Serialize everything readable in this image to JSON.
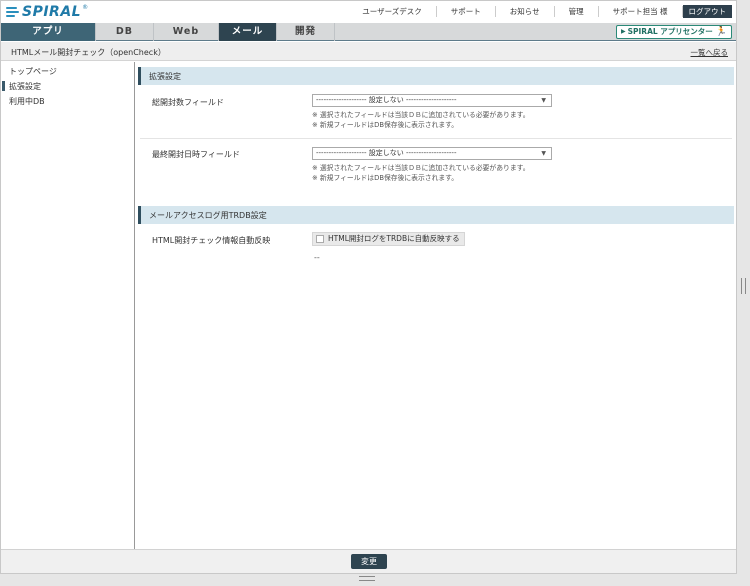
{
  "header": {
    "logo_text": "SPIRAL",
    "logo_reg": "®",
    "links": [
      "ユーザーズデスク",
      "サポート",
      "お知らせ",
      "管理",
      "サポート担当 様"
    ],
    "logout_label": "ログアウト"
  },
  "nav": {
    "tabs": [
      "アプリ",
      "DB",
      "Web",
      "メール",
      "開発"
    ],
    "active_tab": "メール",
    "app_center_label": "SPIRAL アプリセンター",
    "app_center_arrow": "▶",
    "app_center_icon": "person-running-icon"
  },
  "titlebar": {
    "title": "HTMLメール開封チェック（openCheck）",
    "back_link": "一覧へ戻る"
  },
  "sidebar": {
    "items": [
      "トップページ",
      "拡張設定",
      "利用中DB"
    ],
    "active_index": 1
  },
  "sections": {
    "extended": {
      "title": "拡張設定",
      "fields": [
        {
          "label": "総開封数フィールド",
          "select_value": "-------------------- 設定しない --------------------",
          "notes": [
            "※ 選択されたフィールドは当該ＤＢに追加されている必要があります。",
            "※ 新規フィールドはDB保存後に表示されます。"
          ]
        },
        {
          "label": "最終開封日時フィールド",
          "select_value": "-------------------- 設定しない --------------------",
          "notes": [
            "※ 選択されたフィールドは当該ＤＢに追加されている必要があります。",
            "※ 新規フィールドはDB保存後に表示されます。"
          ]
        }
      ]
    },
    "trdb": {
      "title": "メールアクセスログ用TRDB設定",
      "label": "HTML開封チェック情報自動反映",
      "checkbox_label": "HTML開封ログをTRDBに自動反映する",
      "checked": false,
      "value": "--"
    }
  },
  "footer": {
    "submit_label": "変更"
  },
  "colors": {
    "nav_active": "#2e4450",
    "nav_dark": "#3e6576",
    "section_bg": "#d6e6ee",
    "accent_green": "#2b8a78"
  }
}
